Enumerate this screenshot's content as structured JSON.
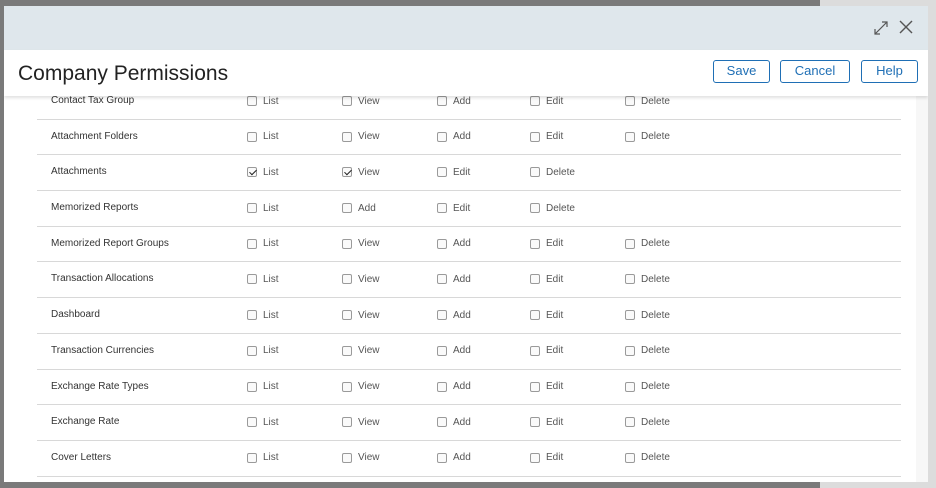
{
  "dialog": {
    "title": "Company Permissions",
    "buttons": {
      "save": "Save",
      "cancel": "Cancel",
      "help": "Help"
    },
    "icons": {
      "expand": "expand-icon",
      "close": "close-icon"
    },
    "accent_color": "#1f6fb5"
  },
  "permission_rows": [
    {
      "label": "Contact Tax Group",
      "permissions": [
        {
          "label": "List",
          "checked": false
        },
        {
          "label": "View",
          "checked": false
        },
        {
          "label": "Add",
          "checked": false
        },
        {
          "label": "Edit",
          "checked": false
        },
        {
          "label": "Delete",
          "checked": false
        }
      ]
    },
    {
      "label": "Attachment Folders",
      "permissions": [
        {
          "label": "List",
          "checked": false
        },
        {
          "label": "View",
          "checked": false
        },
        {
          "label": "Add",
          "checked": false
        },
        {
          "label": "Edit",
          "checked": false
        },
        {
          "label": "Delete",
          "checked": false
        }
      ]
    },
    {
      "label": "Attachments",
      "permissions": [
        {
          "label": "List",
          "checked": true
        },
        {
          "label": "View",
          "checked": true
        },
        {
          "label": "Edit",
          "checked": false
        },
        {
          "label": "Delete",
          "checked": false
        }
      ]
    },
    {
      "label": "Memorized Reports",
      "permissions": [
        {
          "label": "List",
          "checked": false
        },
        {
          "label": "Add",
          "checked": false
        },
        {
          "label": "Edit",
          "checked": false
        },
        {
          "label": "Delete",
          "checked": false
        }
      ]
    },
    {
      "label": "Memorized Report Groups",
      "permissions": [
        {
          "label": "List",
          "checked": false
        },
        {
          "label": "View",
          "checked": false
        },
        {
          "label": "Add",
          "checked": false
        },
        {
          "label": "Edit",
          "checked": false
        },
        {
          "label": "Delete",
          "checked": false
        }
      ]
    },
    {
      "label": "Transaction Allocations",
      "permissions": [
        {
          "label": "List",
          "checked": false
        },
        {
          "label": "View",
          "checked": false
        },
        {
          "label": "Add",
          "checked": false
        },
        {
          "label": "Edit",
          "checked": false
        },
        {
          "label": "Delete",
          "checked": false
        }
      ]
    },
    {
      "label": "Dashboard",
      "permissions": [
        {
          "label": "List",
          "checked": false
        },
        {
          "label": "View",
          "checked": false
        },
        {
          "label": "Add",
          "checked": false
        },
        {
          "label": "Edit",
          "checked": false
        },
        {
          "label": "Delete",
          "checked": false
        }
      ]
    },
    {
      "label": "Transaction Currencies",
      "permissions": [
        {
          "label": "List",
          "checked": false
        },
        {
          "label": "View",
          "checked": false
        },
        {
          "label": "Add",
          "checked": false
        },
        {
          "label": "Edit",
          "checked": false
        },
        {
          "label": "Delete",
          "checked": false
        }
      ]
    },
    {
      "label": "Exchange Rate Types",
      "permissions": [
        {
          "label": "List",
          "checked": false
        },
        {
          "label": "View",
          "checked": false
        },
        {
          "label": "Add",
          "checked": false
        },
        {
          "label": "Edit",
          "checked": false
        },
        {
          "label": "Delete",
          "checked": false
        }
      ]
    },
    {
      "label": "Exchange Rate",
      "permissions": [
        {
          "label": "List",
          "checked": false
        },
        {
          "label": "View",
          "checked": false
        },
        {
          "label": "Add",
          "checked": false
        },
        {
          "label": "Edit",
          "checked": false
        },
        {
          "label": "Delete",
          "checked": false
        }
      ]
    },
    {
      "label": "Cover Letters",
      "permissions": [
        {
          "label": "List",
          "checked": false
        },
        {
          "label": "View",
          "checked": false
        },
        {
          "label": "Add",
          "checked": false
        },
        {
          "label": "Edit",
          "checked": false
        },
        {
          "label": "Delete",
          "checked": false
        }
      ]
    }
  ]
}
